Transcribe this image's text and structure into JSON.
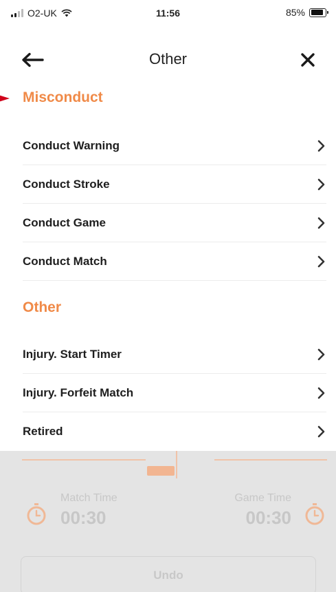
{
  "status_bar": {
    "carrier": "O2-UK",
    "time": "11:56",
    "battery_percent": "85%",
    "battery_level": 0.85
  },
  "header": {
    "title": "Other",
    "back_icon": "arrow-left-icon",
    "close_icon": "close-icon"
  },
  "sections": [
    {
      "heading": "Misconduct",
      "items": [
        {
          "label": "Conduct Warning"
        },
        {
          "label": "Conduct Stroke"
        },
        {
          "label": "Conduct Game"
        },
        {
          "label": "Conduct Match"
        }
      ]
    },
    {
      "heading": "Other",
      "items": [
        {
          "label": "Injury. Start Timer"
        },
        {
          "label": "Injury. Forfeit Match"
        },
        {
          "label": "Retired"
        }
      ]
    }
  ],
  "background": {
    "match_time_label": "Match Time",
    "match_time_value": "00:30",
    "game_time_label": "Game Time",
    "game_time_value": "00:30",
    "undo_label": "Undo"
  },
  "colors": {
    "accent": "#f08a48",
    "annotation_arrow": "#d0021b"
  }
}
